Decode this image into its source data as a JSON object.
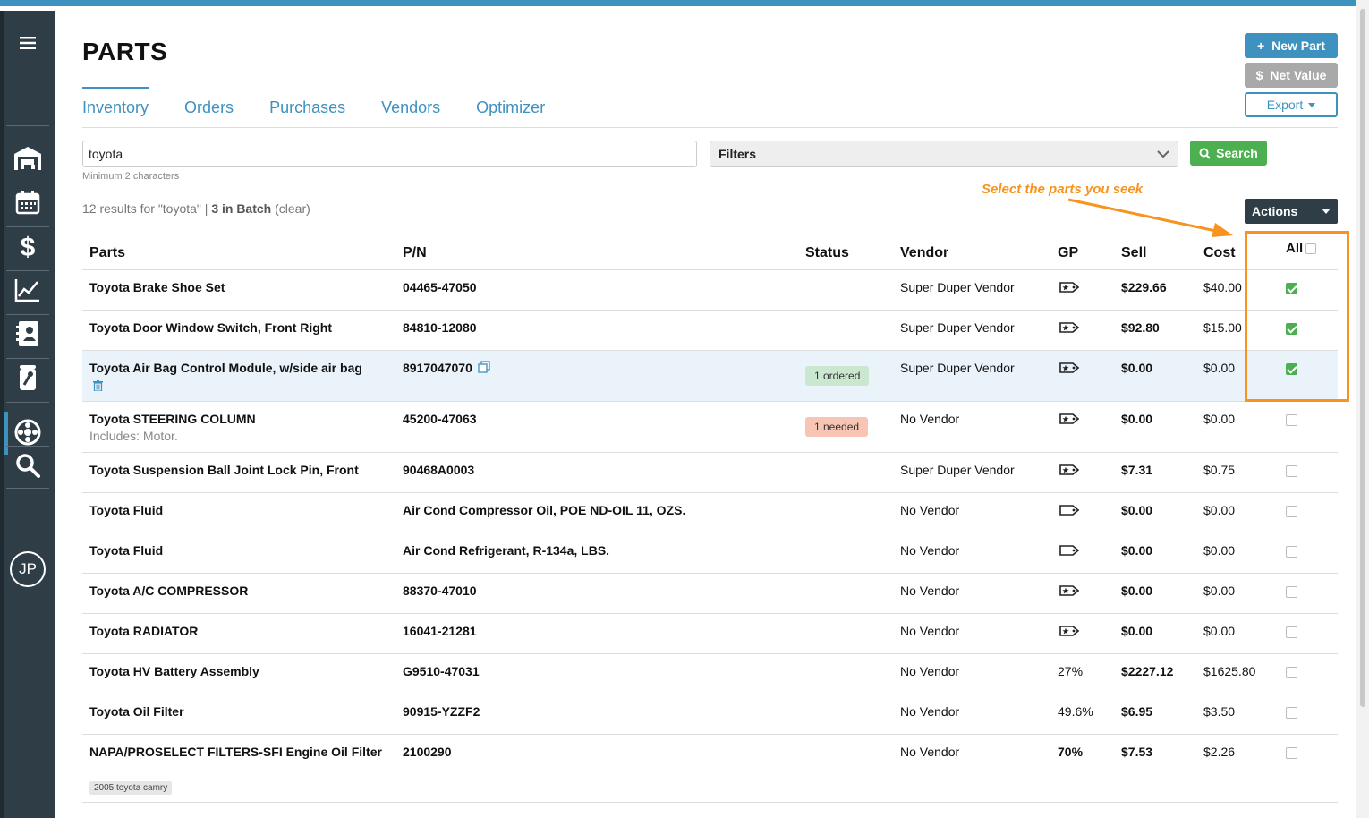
{
  "header": {
    "title": "PARTS",
    "buttons": {
      "new_part": "New Part",
      "net_value": "Net Value",
      "export": "Export"
    }
  },
  "tabs": [
    "Inventory",
    "Orders",
    "Purchases",
    "Vendors",
    "Optimizer"
  ],
  "search": {
    "value": "toyota",
    "hint": "Minimum 2 characters",
    "filters_label": "Filters",
    "button": "Search"
  },
  "results": {
    "prefix": "12 results for \"toyota\" |",
    "batch": "3 in Batch",
    "clear": "(clear)"
  },
  "annotation": {
    "text": "Select the parts you seek",
    "color": "#f7931e"
  },
  "actions_label": "Actions",
  "columns": [
    "Parts",
    "P/N",
    "Status",
    "Vendor",
    "GP",
    "Sell",
    "Cost"
  ],
  "all_label": "All",
  "rows": [
    {
      "part": "Toyota Brake Shoe Set",
      "pn": "04465-47050",
      "status": "",
      "vendor": "Super Duper Vendor",
      "gp": "icon-star-tag",
      "sell": "$229.66",
      "cost": "$40.00",
      "checked": true
    },
    {
      "part": "Toyota Door Window Switch, Front Right",
      "pn": "84810-12080",
      "status": "",
      "vendor": "Super Duper Vendor",
      "gp": "icon-star-tag",
      "sell": "$92.80",
      "cost": "$15.00",
      "checked": true
    },
    {
      "part": "Toyota Air Bag Control Module, w/side air bag",
      "pn": "8917047070",
      "status": "1 ordered",
      "vendor": "Super Duper Vendor",
      "gp": "icon-star-tag",
      "sell": "$0.00",
      "cost": "$0.00",
      "checked": true
    },
    {
      "part": "Toyota STEERING COLUMN",
      "sub": "Includes: Motor.",
      "pn": "45200-47063",
      "status": "1 needed",
      "vendor": "No Vendor",
      "gp": "icon-star-tag",
      "sell": "$0.00",
      "cost": "$0.00",
      "checked": false
    },
    {
      "part": "Toyota Suspension Ball Joint Lock Pin, Front",
      "pn": "90468A0003",
      "status": "",
      "vendor": "Super Duper Vendor",
      "gp": "icon-star-tag",
      "sell": "$7.31",
      "cost": "$0.75",
      "checked": false
    },
    {
      "part": "Toyota Fluid",
      "pn": "Air Cond Compressor Oil, POE ND-OIL 11, OZS.",
      "status": "",
      "vendor": "No Vendor",
      "gp": "icon-tag",
      "sell": "$0.00",
      "cost": "$0.00",
      "checked": false
    },
    {
      "part": "Toyota Fluid",
      "pn": "Air Cond Refrigerant, R-134a, LBS.",
      "status": "",
      "vendor": "No Vendor",
      "gp": "icon-tag",
      "sell": "$0.00",
      "cost": "$0.00",
      "checked": false
    },
    {
      "part": "Toyota A/C COMPRESSOR",
      "pn": "88370-47010",
      "status": "",
      "vendor": "No Vendor",
      "gp": "icon-star-tag",
      "sell": "$0.00",
      "cost": "$0.00",
      "checked": false
    },
    {
      "part": "Toyota RADIATOR",
      "pn": "16041-21281",
      "status": "",
      "vendor": "No Vendor",
      "gp": "icon-star-tag",
      "sell": "$0.00",
      "cost": "$0.00",
      "checked": false
    },
    {
      "part": "Toyota HV Battery Assembly",
      "pn": "G9510-47031",
      "status": "",
      "vendor": "No Vendor",
      "gp": "27%",
      "sell": "$2227.12",
      "cost": "$1625.80",
      "checked": false
    },
    {
      "part": "Toyota Oil Filter",
      "pn": "90915-YZZF2",
      "status": "",
      "vendor": "No Vendor",
      "gp": "49.6%",
      "sell": "$6.95",
      "cost": "$3.50",
      "checked": false
    },
    {
      "part": "NAPA/PROSELECT FILTERS-SFI Engine Oil Filter",
      "pn": "2100290",
      "status": "",
      "vendor": "No Vendor",
      "gp": "70%",
      "sell": "$7.53",
      "cost": "$2.26",
      "checked": false,
      "tag": "2005 toyota camry"
    }
  ],
  "user": {
    "initials": "JP"
  }
}
